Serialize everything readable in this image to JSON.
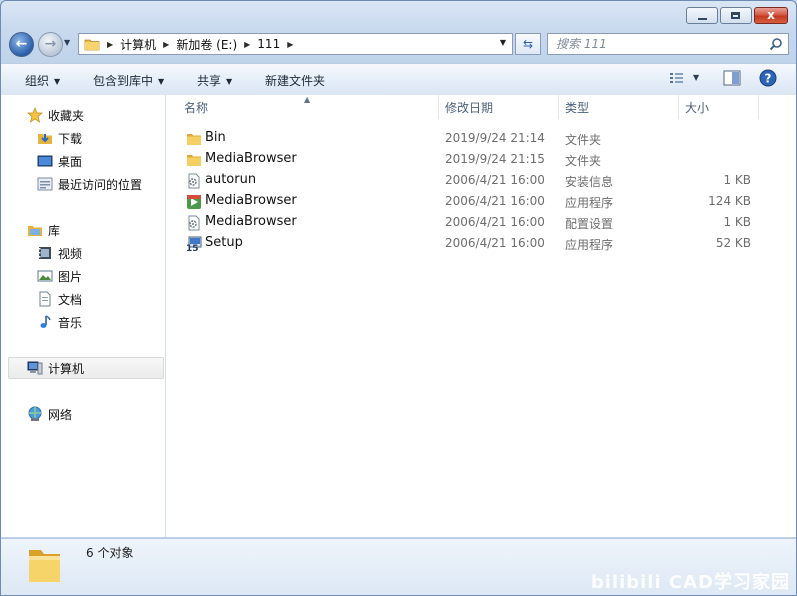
{
  "window": {
    "min_glyph": "",
    "max_glyph": "",
    "close_glyph": "x"
  },
  "address": {
    "crumbs": [
      "计算机",
      "新加卷 (E:)",
      "111"
    ]
  },
  "search": {
    "placeholder": "搜索 111"
  },
  "toolbar": {
    "organize": "组织",
    "include_library": "包含到库中",
    "share": "共享",
    "new_folder": "新建文件夹"
  },
  "nav": {
    "favorites": "收藏夹",
    "downloads": "下载",
    "desktop": "桌面",
    "recent": "最近访问的位置",
    "libraries": "库",
    "videos": "视频",
    "pictures": "图片",
    "documents": "文档",
    "music": "音乐",
    "computer": "计算机",
    "network": "网络"
  },
  "columns": {
    "name": "名称",
    "date": "修改日期",
    "type": "类型",
    "size": "大小"
  },
  "files": [
    {
      "name": "Bin",
      "date": "2019/9/24 21:14",
      "type": "文件夹",
      "size": "",
      "icon": "folder-icon"
    },
    {
      "name": "MediaBrowser",
      "date": "2019/9/24 21:15",
      "type": "文件夹",
      "size": "",
      "icon": "folder-icon"
    },
    {
      "name": "autorun",
      "date": "2006/4/21 16:00",
      "type": "安装信息",
      "size": "1 KB",
      "icon": "setup-info-icon"
    },
    {
      "name": "MediaBrowser",
      "date": "2006/4/21 16:00",
      "type": "应用程序",
      "size": "124 KB",
      "icon": "application-icon"
    },
    {
      "name": "MediaBrowser",
      "date": "2006/4/21 16:00",
      "type": "配置设置",
      "size": "1 KB",
      "icon": "config-settings-icon"
    },
    {
      "name": "Setup",
      "date": "2006/4/21 16:00",
      "type": "应用程序",
      "size": "52 KB",
      "icon": "setup-exe-icon"
    }
  ],
  "status": {
    "count": "6 个对象"
  },
  "watermark": "bilibili CAD学习家园",
  "colors": {
    "accent": "#2a5ea8",
    "folder": "#f2c94c",
    "close": "#c53b22"
  }
}
